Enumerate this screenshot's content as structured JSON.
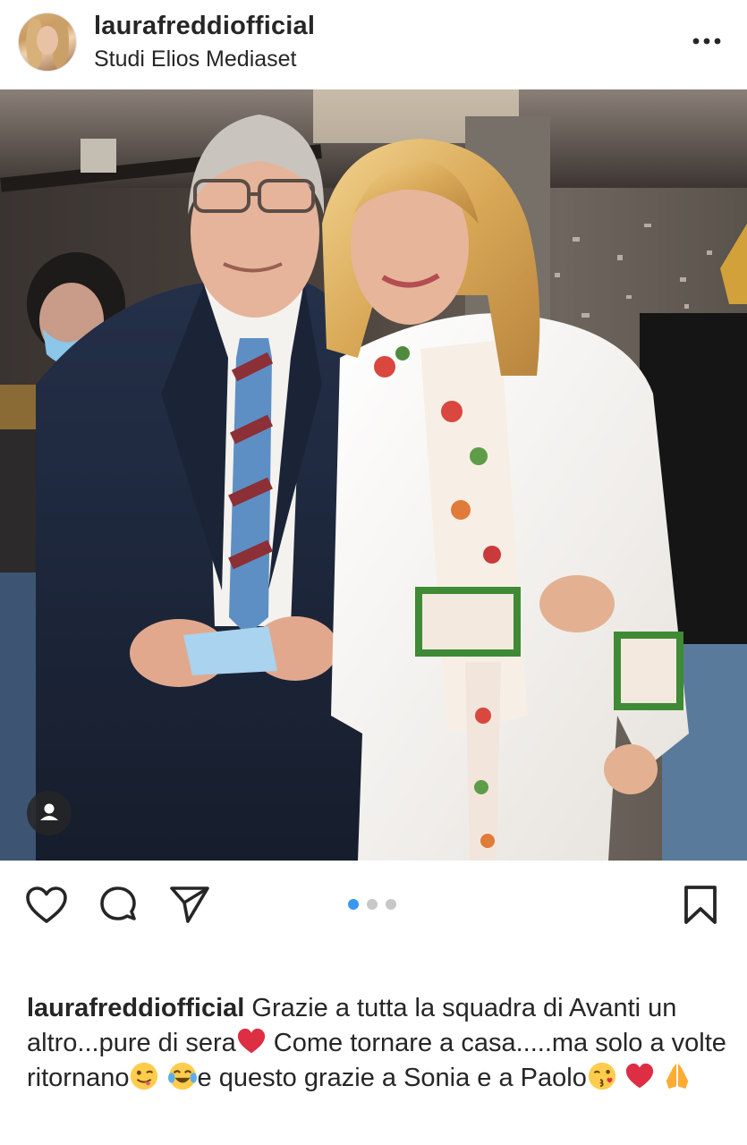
{
  "post": {
    "username": "laurafreddiofficial",
    "location": "Studi Elios Mediaset",
    "more_icon": "more-horizontal-icon",
    "carousel": {
      "count": 3,
      "active_index": 0,
      "active_color": "#3897f0",
      "inactive_color": "#c7c7c7"
    },
    "actions": {
      "like_icon": "heart-icon",
      "comment_icon": "comment-icon",
      "share_icon": "send-icon",
      "save_icon": "bookmark-icon",
      "tags_icon": "user-tag-icon"
    },
    "caption": {
      "username": "laurafreddiofficial",
      "part1": " Grazie a tutta la squadra di Avanti un altro...pure di sera",
      "emoji1": "red-heart-emoji",
      "part2": " Come tornare a casa.....ma solo a volte ritornano",
      "emoji2": "winking-face-with-tongue-emoji",
      "emoji3": "tears-of-joy-emoji",
      "part3": "e questo grazie a Sonia e a Paolo",
      "emoji4": "face-blowing-kiss-emoji",
      "emoji5": "red-heart-emoji",
      "emoji6": "folded-hands-emoji"
    }
  }
}
